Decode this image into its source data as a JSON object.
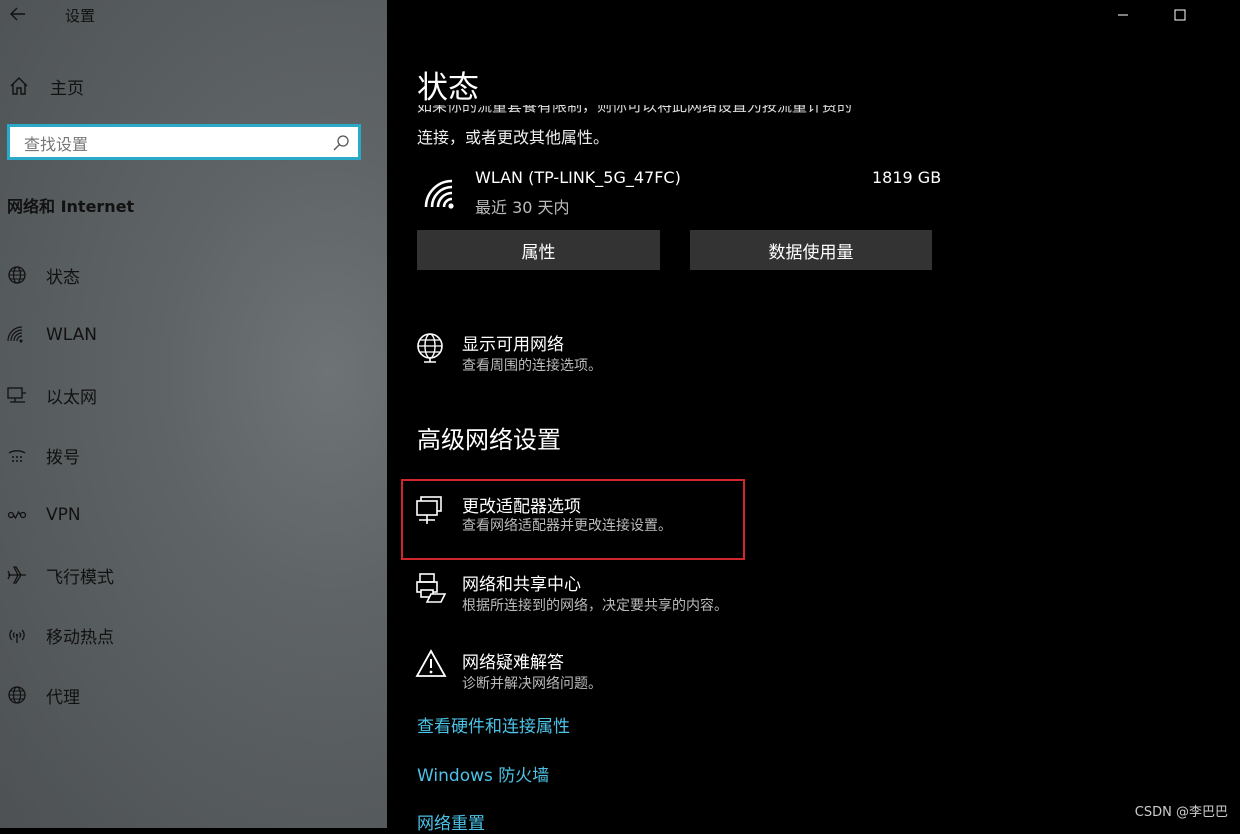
{
  "sidebar": {
    "app_title": "设置",
    "home_label": "主页",
    "search_placeholder": "查找设置",
    "section_title": "网络和 Internet",
    "items": [
      {
        "label": "状态",
        "icon": "globe-icon"
      },
      {
        "label": "WLAN",
        "icon": "wifi-icon"
      },
      {
        "label": "以太网",
        "icon": "ethernet-icon"
      },
      {
        "label": "拨号",
        "icon": "dialup-icon"
      },
      {
        "label": "VPN",
        "icon": "vpn-icon"
      },
      {
        "label": "飞行模式",
        "icon": "airplane-icon"
      },
      {
        "label": "移动热点",
        "icon": "hotspot-icon"
      },
      {
        "label": "代理",
        "icon": "globe-icon"
      }
    ]
  },
  "main": {
    "title": "状态",
    "clipped_text": "如果你的流量套餐有限制，则你可以将此网络设置为按流量计费的",
    "continuation_text": "连接，或者更改其他属性。",
    "wlan": {
      "name": "WLAN (TP-LINK_5G_47FC)",
      "period": "最近 30 天内",
      "usage": "1819 GB"
    },
    "buttons": {
      "properties": "属性",
      "data_usage": "数据使用量"
    },
    "show_networks": {
      "title": "显示可用网络",
      "subtitle": "查看周围的连接选项。"
    },
    "advanced_heading": "高级网络设置",
    "advanced_items": [
      {
        "title": "更改适配器选项",
        "subtitle": "查看网络适配器并更改连接设置。"
      },
      {
        "title": "网络和共享中心",
        "subtitle": "根据所连接到的网络，决定要共享的内容。"
      },
      {
        "title": "网络疑难解答",
        "subtitle": "诊断并解决网络问题。"
      }
    ],
    "links": [
      "查看硬件和连接属性",
      "Windows 防火墙",
      "网络重置"
    ]
  },
  "colors": {
    "accent_link": "#4cc2e6",
    "search_border": "#2aa9c9",
    "highlight_box": "#d0262c"
  },
  "watermark": "CSDN @李巴巴"
}
